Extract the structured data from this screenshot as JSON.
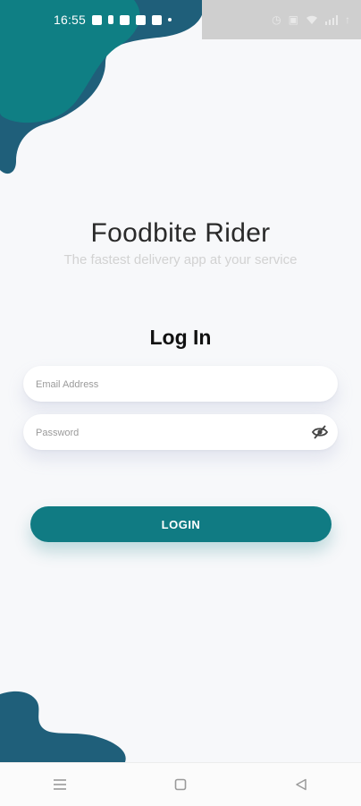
{
  "status_bar": {
    "time": "16:55",
    "right_icons": [
      "alarm-icon",
      "vibrate-icon",
      "wifi-icon",
      "signal-icon",
      "battery-icon"
    ],
    "right_text": "↑"
  },
  "app": {
    "title": "Foodbite Rider",
    "subtitle": "The fastest delivery app at your service"
  },
  "login": {
    "heading": "Log In",
    "email_placeholder": "Email Address",
    "password_placeholder": "Password",
    "button_label": "LOGIN"
  },
  "colors": {
    "primary": "#107b83",
    "blob_dark": "#1f5f7a",
    "blob_teal": "#0f7f84"
  },
  "nav_bar": {
    "icons": [
      "menu-icon",
      "home-icon",
      "back-icon"
    ]
  }
}
